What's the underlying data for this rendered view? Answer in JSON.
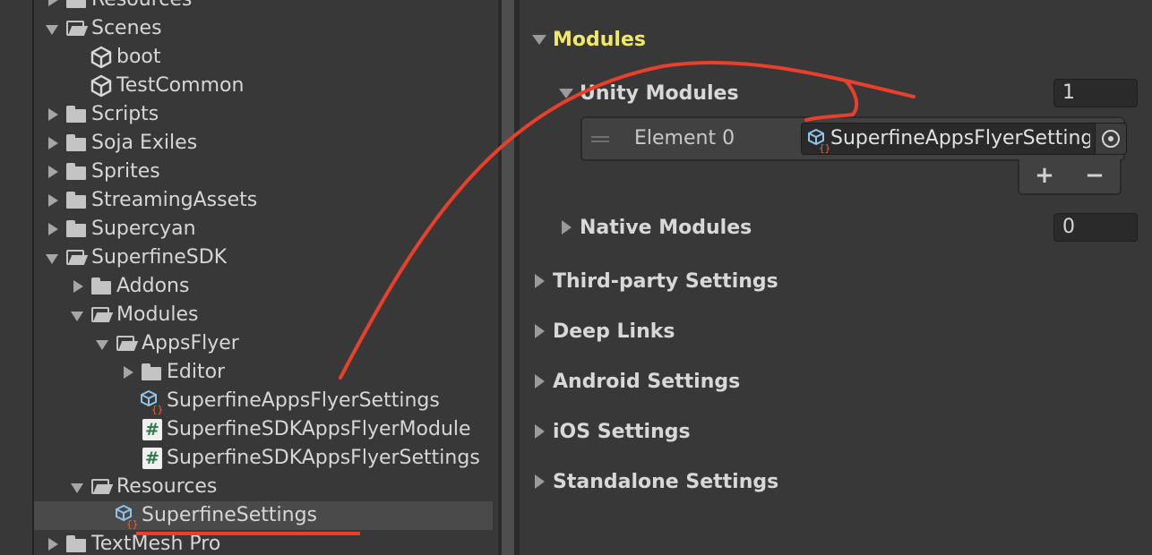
{
  "project_tree": {
    "rows": [
      {
        "label": "Resources",
        "arrow": "right",
        "icon": "folder-closed"
      },
      {
        "label": "Scenes",
        "arrow": "down",
        "icon": "folder-open"
      },
      {
        "label": "boot",
        "arrow": "",
        "icon": "unity-scene"
      },
      {
        "label": "TestCommon",
        "arrow": "",
        "icon": "unity-scene"
      },
      {
        "label": "Scripts",
        "arrow": "right",
        "icon": "folder-closed"
      },
      {
        "label": "Soja Exiles",
        "arrow": "right",
        "icon": "folder-closed"
      },
      {
        "label": "Sprites",
        "arrow": "right",
        "icon": "folder-closed"
      },
      {
        "label": "StreamingAssets",
        "arrow": "right",
        "icon": "folder-closed"
      },
      {
        "label": "Supercyan",
        "arrow": "right",
        "icon": "folder-closed"
      },
      {
        "label": "SuperfineSDK",
        "arrow": "down",
        "icon": "folder-open"
      },
      {
        "label": "Addons",
        "arrow": "right",
        "icon": "folder-closed"
      },
      {
        "label": "Modules",
        "arrow": "down",
        "icon": "folder-open"
      },
      {
        "label": "AppsFlyer",
        "arrow": "down",
        "icon": "folder-open"
      },
      {
        "label": "Editor",
        "arrow": "right",
        "icon": "folder-closed"
      },
      {
        "label": "SuperfineAppsFlyerSettings",
        "arrow": "",
        "icon": "scriptable-object"
      },
      {
        "label": "SuperfineSDKAppsFlyerModule",
        "arrow": "",
        "icon": "csharp-script"
      },
      {
        "label": "SuperfineSDKAppsFlyerSettings",
        "arrow": "",
        "icon": "csharp-script"
      },
      {
        "label": "Resources",
        "arrow": "down",
        "icon": "folder-open"
      },
      {
        "label": "SuperfineSettings",
        "arrow": "",
        "icon": "scriptable-object",
        "selected": true
      },
      {
        "label": "TextMesh Pro",
        "arrow": "right",
        "icon": "folder-closed"
      }
    ]
  },
  "inspector": {
    "modules_label": "Modules",
    "unity_modules": {
      "label": "Unity Modules",
      "size": "1",
      "element_label": "Element 0",
      "element_value": "SuperfineAppsFlyerSettings",
      "add_label": "+",
      "remove_label": "−"
    },
    "native_modules": {
      "label": "Native Modules",
      "size": "0"
    },
    "sections": [
      {
        "label": "Third-party Settings"
      },
      {
        "label": "Deep Links"
      },
      {
        "label": "Android Settings"
      },
      {
        "label": "iOS Settings"
      },
      {
        "label": "Standalone Settings"
      }
    ]
  },
  "colors": {
    "background": "#383838",
    "active_foldout": "#f0e86a",
    "annotation": "#e8402b",
    "field_bg": "#2a2a2a"
  }
}
